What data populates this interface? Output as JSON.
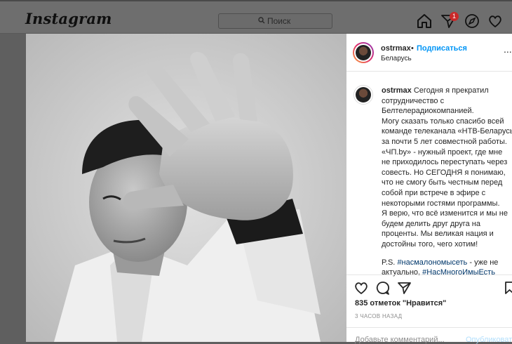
{
  "header": {
    "logo": "Instagram",
    "search_placeholder": "Поиск",
    "notifications_count": "1",
    "icons": [
      "home-icon",
      "direct-icon",
      "explore-icon",
      "activity-heart-icon"
    ]
  },
  "post": {
    "username": "ostrmax",
    "separator": "•",
    "follow_label": "Подписаться",
    "location": "Беларусь",
    "more": "...",
    "caption_username": "ostrmax",
    "caption_lines": [
      "Сегодня я прекратил",
      "сотрудничество с",
      "Белтелерадиокомпанией.",
      "Могу сказать только спасибо всей",
      "команде телеканала «НТВ-Беларусь»",
      "за почти 5 лет совместной работы.",
      "«ЧП.by» - нужный проект, где мне",
      "не приходилось переступать через",
      "совесть. Но СЕГОДНЯ я понимаю,",
      "что не смогу быть честным перед",
      "собой при встрече в эфире с",
      "некоторыми гостями программы.",
      "Я верю, что всё изменится и мы не",
      "будем делить друг друга на",
      "проценты. Мы великая нация и",
      "достойны того, чего хотим!"
    ],
    "ps_prefix": "P.S.",
    "hashtag1": "#насмалономысеть",
    "ps_middle": "- уже не",
    "ps_line2_prefix": "актуально,",
    "hashtag2": "#НасМногоИмыЕсть",
    "likes": "835 отметок \"Нравится\"",
    "time_ago": "3 ЧАСОВ НАЗАД",
    "comment_placeholder": "Добавьте комментарий...",
    "publish_label": "Опубликовать"
  },
  "colors": {
    "accent": "#0095f6",
    "link": "#00376b",
    "badge": "#c92a2a"
  }
}
